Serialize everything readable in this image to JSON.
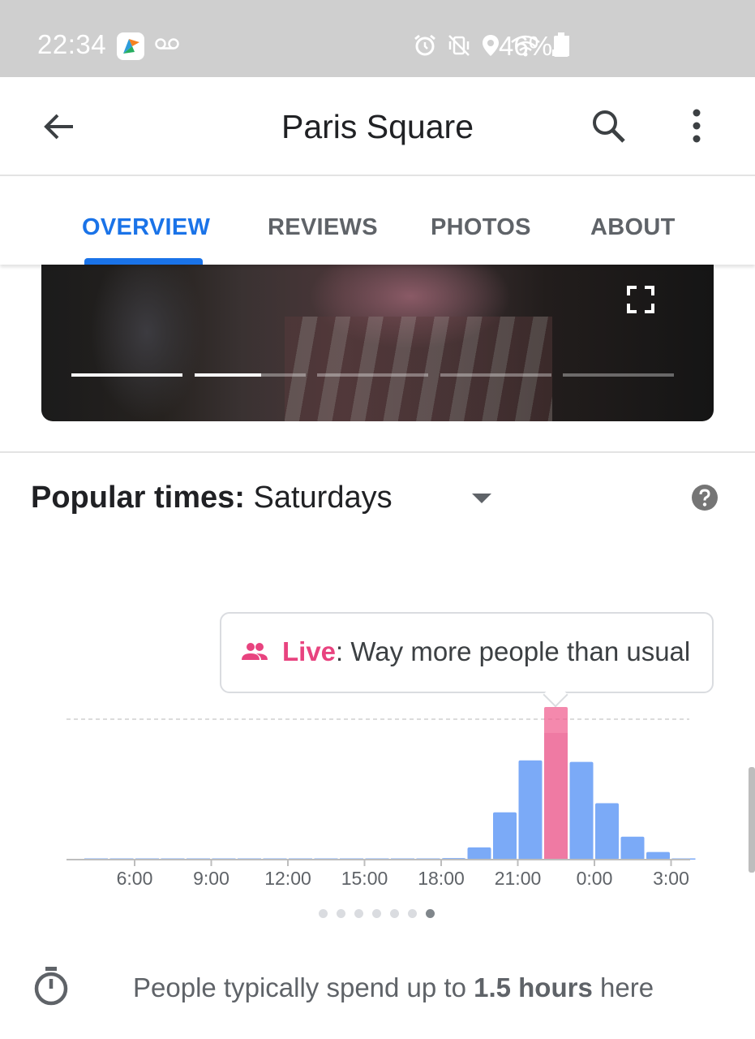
{
  "status_bar": {
    "time": "22:34",
    "battery": "46%",
    "icons": [
      "app-notification-icon",
      "voicemail-icon",
      "alarm-icon",
      "vibrate-icon",
      "location-icon",
      "wifi-icon",
      "signal-icon",
      "battery-icon"
    ]
  },
  "app_bar": {
    "title": "Paris Square",
    "icons": [
      "back-arrow-icon",
      "search-icon",
      "more-vert-icon"
    ]
  },
  "tabs": [
    {
      "label": "OVERVIEW",
      "active": true
    },
    {
      "label": "REVIEWS",
      "active": false
    },
    {
      "label": "PHOTOS",
      "active": false
    },
    {
      "label": "ABOUT",
      "active": false
    }
  ],
  "photo_story": {
    "segments": [
      1.0,
      0.6,
      0.0,
      0.0,
      0.0
    ]
  },
  "popular_times": {
    "label": "Popular times:",
    "day": "Saturdays",
    "live_label": "Live",
    "live_text": ": Way more people than usual",
    "page_dots": 7,
    "active_page": 6
  },
  "chart_data": {
    "type": "bar",
    "x_tick_labels": [
      "6:00",
      "9:00",
      "12:00",
      "15:00",
      "18:00",
      "21:00",
      "0:00",
      "3:00"
    ],
    "hours": [
      4,
      5,
      6,
      7,
      8,
      9,
      10,
      11,
      12,
      13,
      14,
      15,
      16,
      17,
      18,
      19,
      20,
      21,
      22,
      23,
      0,
      1,
      2,
      3
    ],
    "usual": [
      0,
      0,
      0,
      0,
      0,
      0,
      0,
      0,
      0,
      0,
      0,
      0,
      0,
      0,
      1,
      8,
      31,
      65,
      83,
      64,
      37,
      15,
      5,
      0
    ],
    "live": {
      "hour": 22,
      "value": 100
    },
    "reference_line": 100,
    "colors": {
      "usual": "#7baaf7",
      "live": "#f06292",
      "live_overlap": "#ef7aa3",
      "axis": "#bdbdbd"
    }
  },
  "dwell": {
    "prefix": "People typically spend up to ",
    "duration": "1.5 hours",
    "suffix": " here"
  }
}
